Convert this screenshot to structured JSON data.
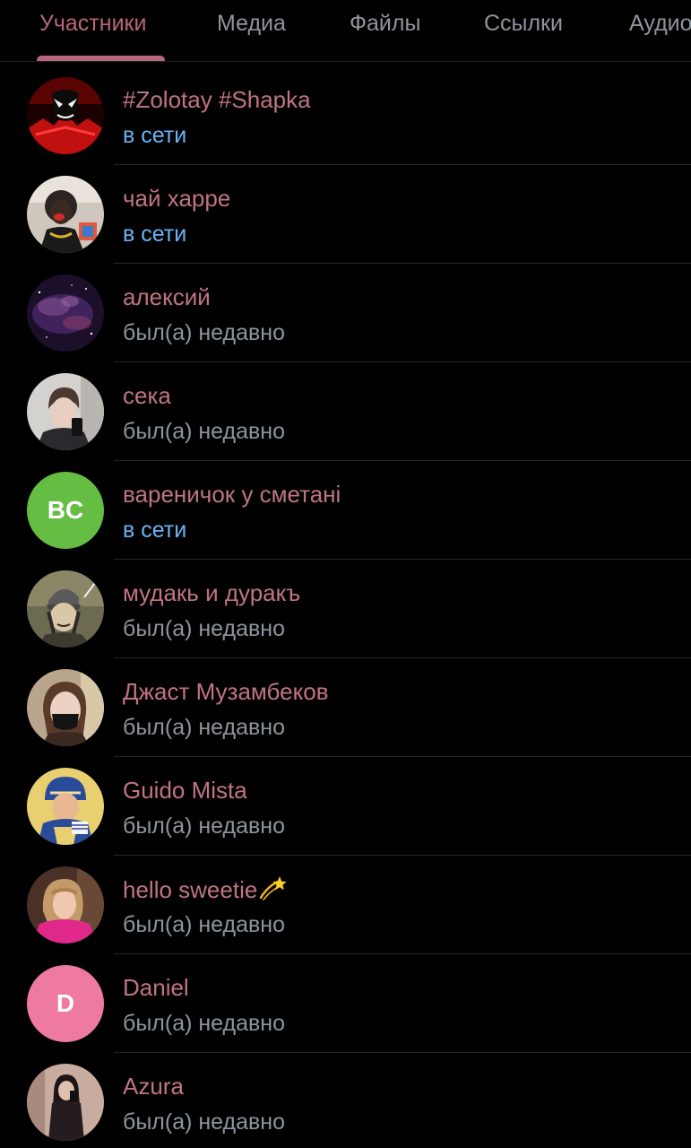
{
  "tabs": [
    {
      "label": "Участники",
      "active": true
    },
    {
      "label": "Медиа",
      "active": false
    },
    {
      "label": "Файлы",
      "active": false
    },
    {
      "label": "Ссылки",
      "active": false
    },
    {
      "label": "Аудио",
      "active": false
    }
  ],
  "colors": {
    "accent": "#b8677a",
    "name": "#c07484",
    "online": "#6ab3f3",
    "offline": "#8e949c",
    "background": "#000000"
  },
  "members": [
    {
      "name": "#Zolotay #Shapka",
      "status": "в сети",
      "online": true,
      "avatar": "red-masked-hero-avatar"
    },
    {
      "name": "чай харре",
      "status": "в сети",
      "online": true,
      "avatar": "face-paint-photo-avatar"
    },
    {
      "name": "алексий",
      "status": "был(а) недавно",
      "online": false,
      "avatar": "nebula-space-avatar"
    },
    {
      "name": "сека",
      "status": "был(а) недавно",
      "online": false,
      "avatar": "mirror-selfie-avatar"
    },
    {
      "name": "вареничок у сметанi",
      "status": "в сети",
      "online": true,
      "avatar_initials": "BC",
      "avatar_color": "#66bd44"
    },
    {
      "name": "мудакь и дуракъ",
      "status": "был(а) недавно",
      "online": false,
      "avatar": "drawn-beanie-character-avatar"
    },
    {
      "name": "Джаст Музамбеков",
      "status": "был(а) недавно",
      "online": false,
      "avatar": "black-face-mask-photo-avatar"
    },
    {
      "name": "Guido Mista",
      "status": "был(а) недавно",
      "online": false,
      "avatar": "anime-character-avatar"
    },
    {
      "name": "hello sweetie",
      "name_emoji": "dizzy-star-emoji",
      "status": "был(а) недавно",
      "online": false,
      "avatar": "pink-jacket-photo-avatar"
    },
    {
      "name": "Daniel",
      "status": "был(а) недавно",
      "online": false,
      "avatar_initials": "D",
      "avatar_color": "#ee7aa2"
    },
    {
      "name": "Azura",
      "status": "был(а) недавно",
      "online": false,
      "avatar": "mirror-photo-avatar"
    }
  ]
}
